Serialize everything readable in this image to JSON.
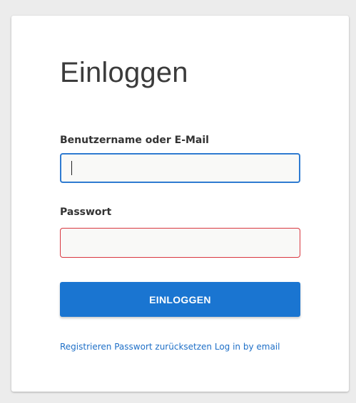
{
  "form": {
    "title": "Einloggen",
    "username_label": "Benutzername oder E-Mail",
    "username_value": "",
    "password_label": "Passwort",
    "password_value": "",
    "submit_label": "EINLOGGEN"
  },
  "links": {
    "register": "Registrieren",
    "reset_password": "Passwort zurücksetzen",
    "email_login": "Log in by email"
  },
  "colors": {
    "accent": "#1a75d1",
    "focus_border": "#2f7bd1",
    "error_border": "#d9373f",
    "link": "#1e6fc7"
  }
}
